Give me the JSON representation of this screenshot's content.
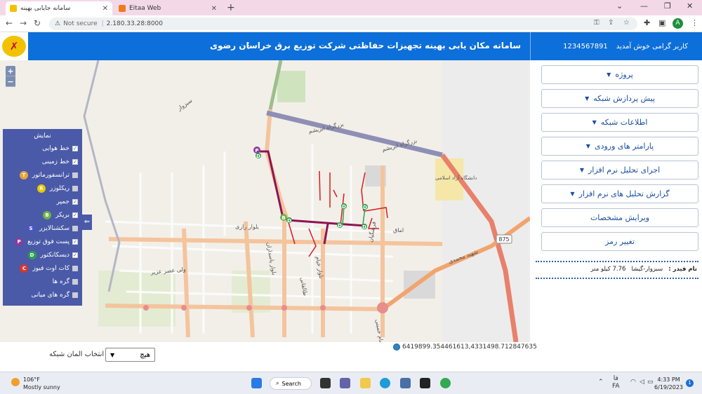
{
  "browser": {
    "tabs": [
      {
        "title": "سامانه جایابی بهینه",
        "active": true
      },
      {
        "title": "Eitaa Web",
        "active": false
      }
    ],
    "new_tab": "+",
    "address": {
      "security": "Not secure",
      "url": "2.180.33.28:8000"
    },
    "profile_initial": "A"
  },
  "app": {
    "title": "سامانه مکان یابی بهینه تجهیزات حفاظتی شرکت توزیع برق خراسان رضوی",
    "menu_kebab": "⋮",
    "user": {
      "greeting": "کاربر گرامی خوش آمدید",
      "id": "1234567891"
    }
  },
  "map": {
    "zoom_in": "+",
    "zoom_out": "−",
    "collapse_icon": "⇐",
    "coordinates": "6419899.354461613,4331498.712847635",
    "labels": {
      "highway": "بزرگراه ابریشم",
      "highway2": "بزرگراه ابریشم",
      "road_875": "875",
      "street_razi": "بلوار رازی",
      "street_daneshgah": "دانشگاه آزاد اسلامی",
      "street_pasdaran": "بلوار پاسداران",
      "street_farhangian": "فرهنگیان",
      "street_shohada": "شهید محمدی",
      "street_bahar": "اماق",
      "street_asr": "ولی عصر عزیر",
      "street_talebani": "طالقانی",
      "street_khayam": "بلوار خیام",
      "street_sabzevar": "سبزوار",
      "street_imam": "امام خمینی"
    },
    "layers": {
      "header": "نمایش",
      "items": [
        {
          "label": "خط هوایی",
          "checked": true,
          "badge": "",
          "color": ""
        },
        {
          "label": "خط زمینی",
          "checked": true,
          "badge": "",
          "color": ""
        },
        {
          "label": "ترانسفورماتور",
          "checked": false,
          "badge": "T",
          "color": "#e8a43a"
        },
        {
          "label": "ریکلوزر",
          "checked": false,
          "badge": "R",
          "color": "#e6c800"
        },
        {
          "label": "جمپر",
          "checked": true,
          "badge": "",
          "color": ""
        },
        {
          "label": "بریکر",
          "checked": true,
          "badge": "B",
          "color": "#6fb24a"
        },
        {
          "label": "سکشنالایزر",
          "checked": false,
          "badge": "S",
          "color": "#4b55c4"
        },
        {
          "label": "پست فوق توزیع",
          "checked": true,
          "badge": "P",
          "color": "#8a3c9c"
        },
        {
          "label": "دیسکانکتور",
          "checked": true,
          "badge": "D",
          "color": "#2f9e4e"
        },
        {
          "label": "کات اوت فیوز",
          "checked": false,
          "badge": "C",
          "color": "#d8362f"
        },
        {
          "label": "گره ها",
          "checked": false,
          "badge": "",
          "color": ""
        },
        {
          "label": "گره های میانی",
          "checked": false,
          "badge": "",
          "color": ""
        }
      ]
    }
  },
  "network_select": {
    "label": "انتخاب المان شبکه",
    "value": "هیچ"
  },
  "sidebar": {
    "menu": [
      {
        "label": "پروژه",
        "caret": true
      },
      {
        "label": "پیش پردازش شبکه",
        "caret": true
      },
      {
        "label": "اطلاعات شبکه",
        "caret": true
      },
      {
        "label": "پارامتر های ورودی",
        "caret": true
      },
      {
        "label": "اجرای تحلیل نرم افزار",
        "caret": true
      },
      {
        "label": "گزارش تحلیل های نرم افزار",
        "caret": true
      },
      {
        "label": "ویرایش مشخصات",
        "caret": false
      },
      {
        "label": "تغییر رمز",
        "caret": false
      }
    ],
    "feeder": {
      "label": "نام فیدر :",
      "name": "سبزوار-گیشا",
      "length": "7.76 کیلو متر"
    }
  },
  "taskbar": {
    "weather": {
      "temp": "106°F",
      "desc": "Mostly sunny"
    },
    "search": "Search",
    "lang": {
      "line1": "فا",
      "line2": "FA"
    },
    "time": "4:33 PM",
    "date": "6/19/2023",
    "notifications": "1"
  }
}
